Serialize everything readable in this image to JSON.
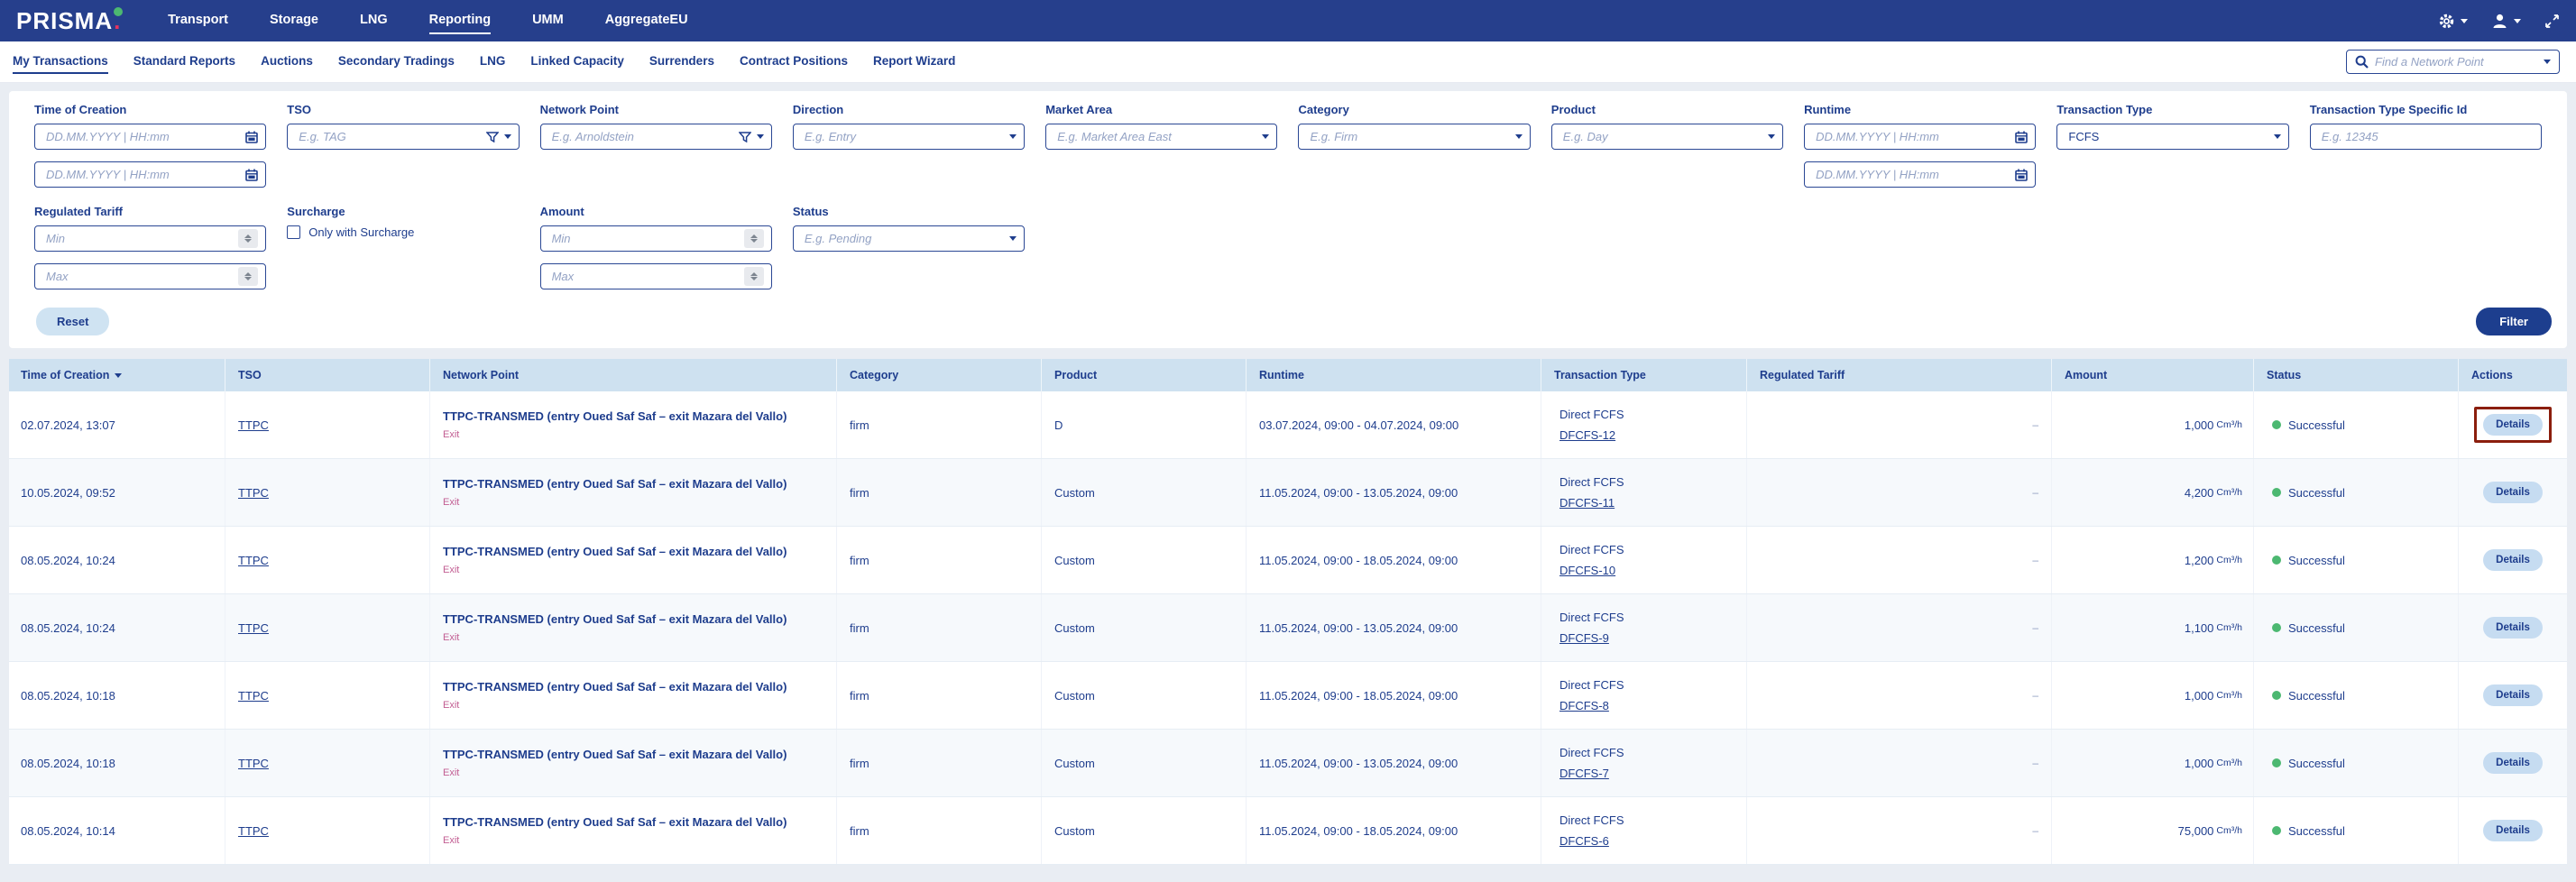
{
  "colors": {
    "navbar": "#263f8c",
    "navy_text": "#1e3d8d",
    "logo_dot_pink": "#e8335f",
    "table_header_bg": "#cee1f0",
    "row_alt_bg": "#f6f9fc",
    "exit_pink": "#c25d92",
    "status_green": "#4cb871",
    "details_btn_bg": "#c6dcf1",
    "reset_btn_bg": "#cfe3f2",
    "filter_btn_bg": "#1d3e8e",
    "highlight_border": "#8b1e0d"
  },
  "topnav": {
    "logo": "PRISMA",
    "logo_dot": ".",
    "items": [
      {
        "label": "Transport",
        "active": false
      },
      {
        "label": "Storage",
        "active": false
      },
      {
        "label": "LNG",
        "active": false
      },
      {
        "label": "Reporting",
        "active": true
      },
      {
        "label": "UMM",
        "active": false
      },
      {
        "label": "AggregateEU",
        "active": false
      }
    ],
    "icons": [
      "gear-icon",
      "user-icon",
      "expand-icon"
    ]
  },
  "subnav": {
    "items": [
      {
        "label": "My Transactions",
        "active": true
      },
      {
        "label": "Standard Reports",
        "active": false
      },
      {
        "label": "Auctions",
        "active": false
      },
      {
        "label": "Secondary Tradings",
        "active": false
      },
      {
        "label": "LNG",
        "active": false
      },
      {
        "label": "Linked Capacity",
        "active": false
      },
      {
        "label": "Surrenders",
        "active": false
      },
      {
        "label": "Contract Positions",
        "active": false
      },
      {
        "label": "Report Wizard",
        "active": false
      }
    ],
    "search": {
      "placeholder": "Find a Network Point",
      "value": ""
    }
  },
  "filters": {
    "time_of_creation": {
      "label": "Time of Creation",
      "from_placeholder": "DD.MM.YYYY | HH:mm",
      "to_placeholder": "DD.MM.YYYY | HH:mm"
    },
    "tso": {
      "label": "TSO",
      "placeholder": "E.g. TAG"
    },
    "network_point": {
      "label": "Network Point",
      "placeholder": "E.g. Arnoldstein"
    },
    "direction": {
      "label": "Direction",
      "placeholder": "E.g. Entry"
    },
    "market_area": {
      "label": "Market Area",
      "placeholder": "E.g. Market Area East"
    },
    "category": {
      "label": "Category",
      "placeholder": "E.g. Firm"
    },
    "product": {
      "label": "Product",
      "placeholder": "E.g. Day"
    },
    "runtime": {
      "label": "Runtime",
      "from_placeholder": "DD.MM.YYYY | HH:mm",
      "to_placeholder": "DD.MM.YYYY | HH:mm"
    },
    "transaction_type": {
      "label": "Transaction Type",
      "value": "FCFS"
    },
    "transaction_type_specific_id": {
      "label": "Transaction Type Specific Id",
      "placeholder": "E.g. 12345"
    },
    "regulated_tariff": {
      "label": "Regulated Tariff",
      "min_placeholder": "Min",
      "max_placeholder": "Max"
    },
    "surcharge": {
      "label": "Surcharge",
      "checkbox_label": "Only with Surcharge",
      "checked": false
    },
    "amount": {
      "label": "Amount",
      "min_placeholder": "Min",
      "max_placeholder": "Max"
    },
    "status": {
      "label": "Status",
      "placeholder": "E.g. Pending"
    },
    "reset_label": "Reset",
    "filter_label": "Filter"
  },
  "table": {
    "columns": [
      "Time of Creation",
      "TSO",
      "Network Point",
      "Category",
      "Product",
      "Runtime",
      "Transaction Type",
      "Regulated Tariff",
      "Amount",
      "Status",
      "Actions"
    ],
    "sort": {
      "column": "Time of Creation",
      "direction": "desc"
    },
    "rows": [
      {
        "time": "02.07.2024, 13:07",
        "tso": "TTPC",
        "network_point": "TTPC-TRANSMED (entry Oued Saf Saf – exit Mazara del Vallo)",
        "direction": "Exit",
        "category": "firm",
        "product": "D",
        "runtime": "03.07.2024, 09:00 - 04.07.2024, 09:00",
        "transaction_type": "Direct FCFS",
        "transaction_id": "DFCFS-12",
        "regulated_tariff": "–",
        "amount": "1,000",
        "amount_unit": "Cm³/h",
        "status": "Successful",
        "action": "Details",
        "highlighted": true
      },
      {
        "time": "10.05.2024, 09:52",
        "tso": "TTPC",
        "network_point": "TTPC-TRANSMED (entry Oued Saf Saf – exit Mazara del Vallo)",
        "direction": "Exit",
        "category": "firm",
        "product": "Custom",
        "runtime": "11.05.2024, 09:00 - 13.05.2024, 09:00",
        "transaction_type": "Direct FCFS",
        "transaction_id": "DFCFS-11",
        "regulated_tariff": "–",
        "amount": "4,200",
        "amount_unit": "Cm³/h",
        "status": "Successful",
        "action": "Details",
        "highlighted": false
      },
      {
        "time": "08.05.2024, 10:24",
        "tso": "TTPC",
        "network_point": "TTPC-TRANSMED (entry Oued Saf Saf – exit Mazara del Vallo)",
        "direction": "Exit",
        "category": "firm",
        "product": "Custom",
        "runtime": "11.05.2024, 09:00 - 18.05.2024, 09:00",
        "transaction_type": "Direct FCFS",
        "transaction_id": "DFCFS-10",
        "regulated_tariff": "–",
        "amount": "1,200",
        "amount_unit": "Cm³/h",
        "status": "Successful",
        "action": "Details",
        "highlighted": false
      },
      {
        "time": "08.05.2024, 10:24",
        "tso": "TTPC",
        "network_point": "TTPC-TRANSMED (entry Oued Saf Saf – exit Mazara del Vallo)",
        "direction": "Exit",
        "category": "firm",
        "product": "Custom",
        "runtime": "11.05.2024, 09:00 - 13.05.2024, 09:00",
        "transaction_type": "Direct FCFS",
        "transaction_id": "DFCFS-9",
        "regulated_tariff": "–",
        "amount": "1,100",
        "amount_unit": "Cm³/h",
        "status": "Successful",
        "action": "Details",
        "highlighted": false
      },
      {
        "time": "08.05.2024, 10:18",
        "tso": "TTPC",
        "network_point": "TTPC-TRANSMED (entry Oued Saf Saf – exit Mazara del Vallo)",
        "direction": "Exit",
        "category": "firm",
        "product": "Custom",
        "runtime": "11.05.2024, 09:00 - 18.05.2024, 09:00",
        "transaction_type": "Direct FCFS",
        "transaction_id": "DFCFS-8",
        "regulated_tariff": "–",
        "amount": "1,000",
        "amount_unit": "Cm³/h",
        "status": "Successful",
        "action": "Details",
        "highlighted": false
      },
      {
        "time": "08.05.2024, 10:18",
        "tso": "TTPC",
        "network_point": "TTPC-TRANSMED (entry Oued Saf Saf – exit Mazara del Vallo)",
        "direction": "Exit",
        "category": "firm",
        "product": "Custom",
        "runtime": "11.05.2024, 09:00 - 13.05.2024, 09:00",
        "transaction_type": "Direct FCFS",
        "transaction_id": "DFCFS-7",
        "regulated_tariff": "–",
        "amount": "1,000",
        "amount_unit": "Cm³/h",
        "status": "Successful",
        "action": "Details",
        "highlighted": false
      },
      {
        "time": "08.05.2024, 10:14",
        "tso": "TTPC",
        "network_point": "TTPC-TRANSMED (entry Oued Saf Saf – exit Mazara del Vallo)",
        "direction": "Exit",
        "category": "firm",
        "product": "Custom",
        "runtime": "11.05.2024, 09:00 - 18.05.2024, 09:00",
        "transaction_type": "Direct FCFS",
        "transaction_id": "DFCFS-6",
        "regulated_tariff": "–",
        "amount": "75,000",
        "amount_unit": "Cm³/h",
        "status": "Successful",
        "action": "Details",
        "highlighted": false
      }
    ]
  }
}
